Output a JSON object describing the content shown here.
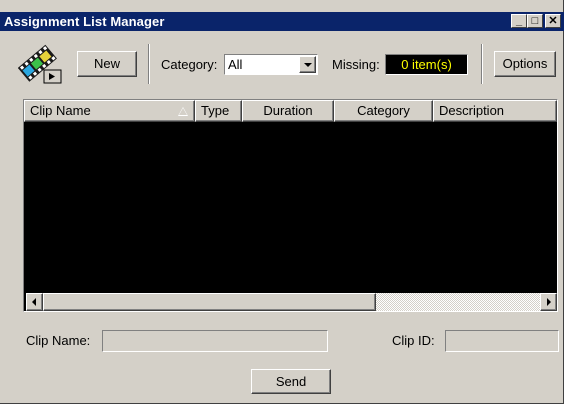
{
  "window": {
    "title": "Assignment List Manager",
    "minimize": "_",
    "maximize": "□",
    "close": "✕"
  },
  "toolbar": {
    "app_icon": "film-clip-icon",
    "new_label": "New",
    "category_label": "Category:",
    "category_value": "All",
    "missing_label": "Missing:",
    "missing_value": "0 item(s)",
    "options_label": "Options"
  },
  "list": {
    "columns": [
      "Clip Name",
      "Type",
      "Duration",
      "Category",
      "Description"
    ],
    "rows": []
  },
  "form": {
    "clip_name_label": "Clip Name:",
    "clip_name_value": "",
    "clip_id_label": "Clip ID:",
    "clip_id_value": "",
    "send_label": "Send"
  },
  "colors": {
    "title_bar": "#0a246a",
    "face": "#d4d0c8",
    "list_bg": "#000000",
    "missing_text": "#ffff00"
  }
}
